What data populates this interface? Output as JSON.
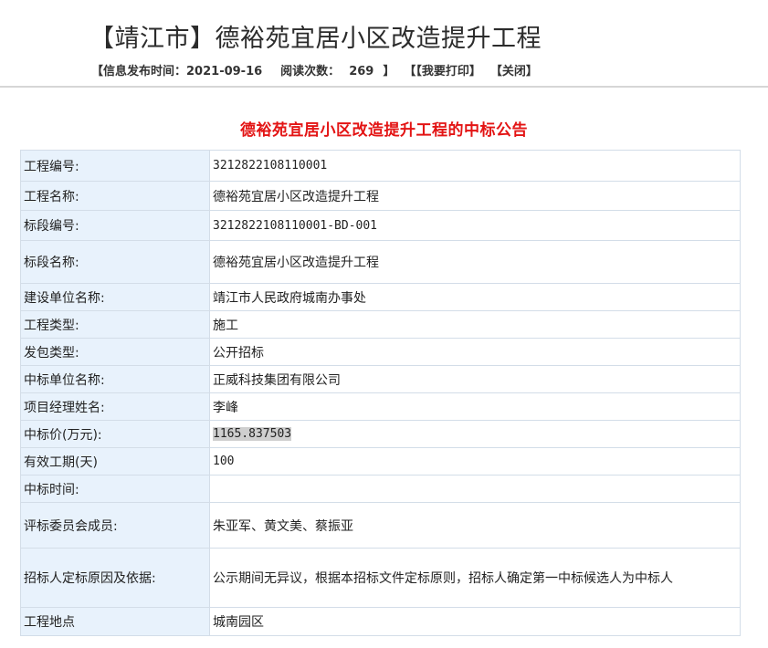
{
  "header": {
    "title": "【靖江市】德裕苑宜居小区改造提升工程",
    "publish_label": "【信息发布时间：",
    "publish_date": "2021-09-16",
    "read_label": "阅读次数：",
    "read_count": "269",
    "read_close": "】",
    "print_link": "【【我要打印】",
    "close_link": "【关闭】"
  },
  "notice": {
    "title": "德裕苑宜居小区改造提升工程的中标公告"
  },
  "rows": [
    {
      "key": "工程编号:",
      "value": "3212822108110001"
    },
    {
      "key": "工程名称:",
      "value": "德裕苑宜居小区改造提升工程"
    },
    {
      "key": "标段编号:",
      "value": "3212822108110001-BD-001"
    },
    {
      "key": "标段名称:",
      "value": "德裕苑宜居小区改造提升工程"
    },
    {
      "key": "建设单位名称:",
      "value": "靖江市人民政府城南办事处"
    },
    {
      "key": "工程类型:",
      "value": "施工"
    },
    {
      "key": "发包类型:",
      "value": "公开招标"
    },
    {
      "key": "中标单位名称:",
      "value": "正威科技集团有限公司"
    },
    {
      "key": "项目经理姓名:",
      "value": "李峰"
    },
    {
      "key": "中标价(万元):",
      "value": "1165.837503"
    },
    {
      "key": "有效工期(天)",
      "value": "100"
    },
    {
      "key": "中标时间:",
      "value": ""
    },
    {
      "key": "评标委员会成员:",
      "value": "朱亚军、黄文美、蔡振亚"
    },
    {
      "key": "招标人定标原因及依据:",
      "value": "公示期间无异议，根据本招标文件定标原则，招标人确定第一中标候选人为中标人"
    },
    {
      "key": "工程地点",
      "value": "城南园区"
    }
  ]
}
